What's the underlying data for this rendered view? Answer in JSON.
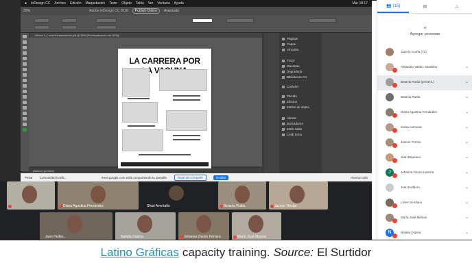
{
  "menubar": {
    "items": [
      "InDesign CC",
      "Archivo",
      "Edición",
      "Maquetación",
      "Texto",
      "Objeto",
      "Tabla",
      "Ver",
      "Ventana",
      "Ayuda"
    ],
    "clock": "Mar 18:17"
  },
  "indesign": {
    "zoom": "25%",
    "window_title": "Adobe InDesign CC 2018",
    "publish_button": "Publish Online",
    "workspace": "Avanzado",
    "doc_tab": "*Afiche 2_LaurenDesasosimidi.pdf @ 25% [Previsualización de GPU]",
    "status": "(Básico) (prueba)",
    "page_title": "LA CARRERA POR LA VACUNA",
    "panels": [
      "Páginas",
      "Capas",
      "Vínculos",
      "Trazo",
      "Muestras",
      "Degradado",
      "Bibliotecas CC",
      "Carácter",
      "Párrafo",
      "Efectos",
      "Estilos de objeto",
      "Alinear",
      "Buscadores",
      "Estilo tabla",
      "Celdr tema"
    ]
  },
  "meet_notice": {
    "left": "Pintar",
    "left2": "Comunidad Grafic...",
    "message": "meet.google.com está compartiendo tu pantalla.",
    "stop": "Dejar de compartir",
    "hide": "Ocultar",
    "close": "Ahorrar todo"
  },
  "videos": [
    {
      "name": ""
    },
    {
      "name": "Diana Agustina Fernández"
    },
    {
      "name": "Shari Aventaño"
    },
    {
      "name": "Betania Ruttia"
    },
    {
      "name": "Jazmin Troche"
    },
    {
      "name": "Juan Heilbo..."
    },
    {
      "name": "Natalia Ospina"
    },
    {
      "name": "Johanna Osorio Herrera"
    },
    {
      "name": "María José Mesías"
    }
  ],
  "participants_panel": {
    "tab_people": "(15)",
    "add_label": "Agregar personas",
    "people": [
      {
        "name": "Jazmín Acuña (Tú)",
        "initial": ""
      },
      {
        "name": "Alejandro Valdez Sanabria",
        "initial": ""
      },
      {
        "name": "Betania Ruttia (present.)",
        "initial": ""
      },
      {
        "name": "Betania Ruttia",
        "initial": ""
      },
      {
        "name": "Diana Agustina Fernández",
        "initial": ""
      },
      {
        "name": "eloisa carmona",
        "initial": ""
      },
      {
        "name": "Jazmín Troche",
        "initial": ""
      },
      {
        "name": "Jean Bejarano",
        "initial": ""
      },
      {
        "name": "Johanna Osorio Herrera",
        "initial": "J"
      },
      {
        "name": "Juan Heilborn",
        "initial": ""
      },
      {
        "name": "Loren Giordano",
        "initial": ""
      },
      {
        "name": "María José Mesías",
        "initial": ""
      },
      {
        "name": "Natalia Ospina",
        "initial": "N"
      }
    ]
  },
  "caption": {
    "link": "Latino Gráficas",
    "text": "capacity training.",
    "source_label": "Source:",
    "source": "El Surtidor"
  }
}
